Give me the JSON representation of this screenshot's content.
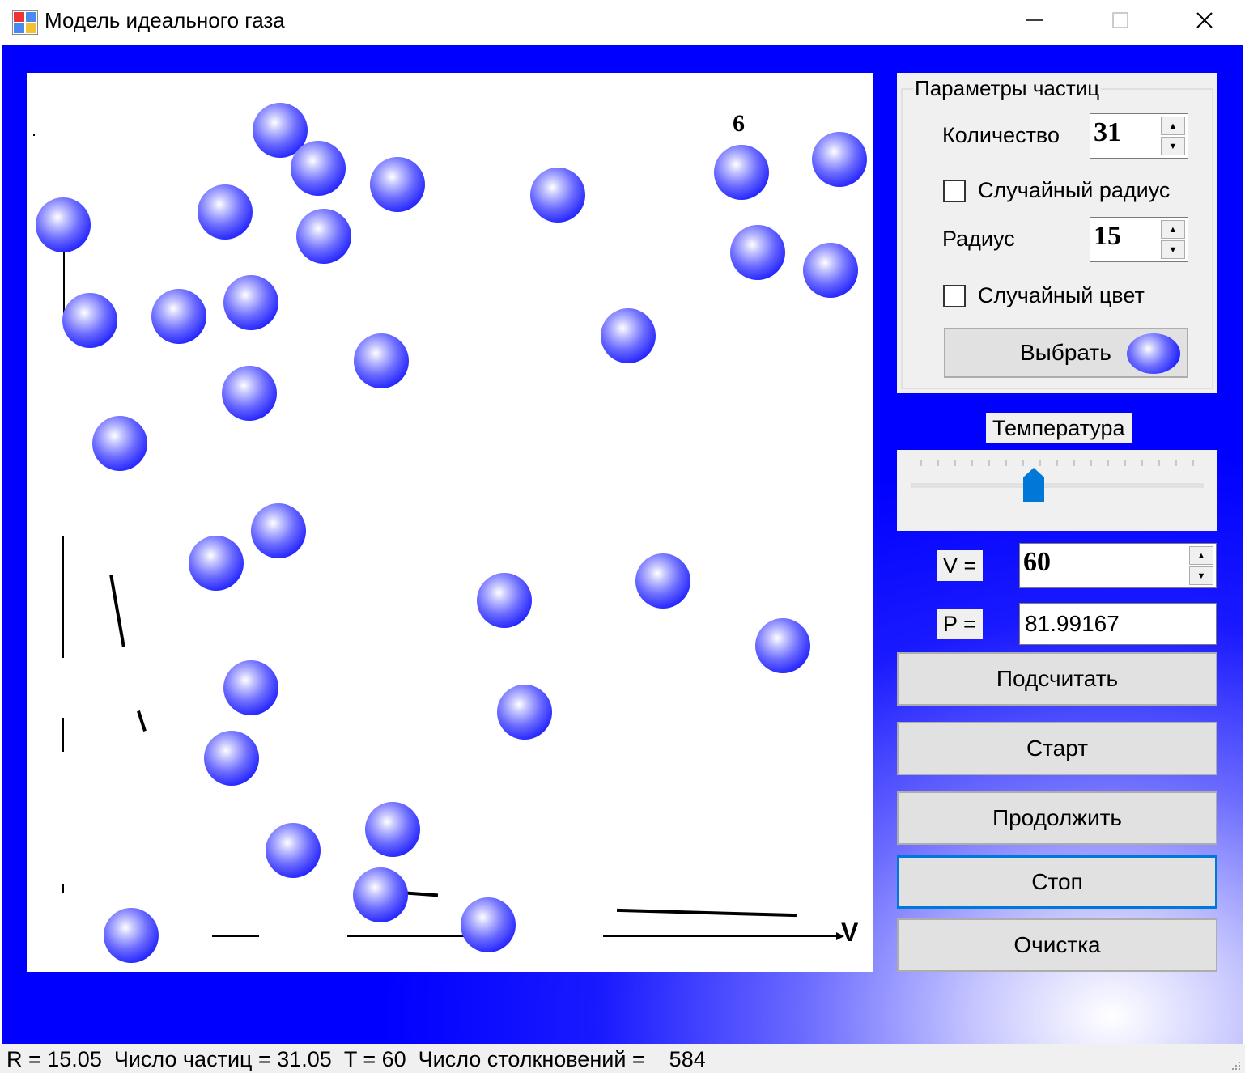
{
  "window": {
    "title": "Модель идеального газа"
  },
  "params_group": {
    "caption": "Параметры частиц",
    "count_label": "Количество",
    "count_value": "31",
    "random_radius_label": "Случайный радиус",
    "random_radius_checked": false,
    "radius_label": "Радиус",
    "radius_value": "15",
    "random_color_label": "Случайный цвет",
    "random_color_checked": false,
    "choose_button": "Выбрать"
  },
  "temperature": {
    "label": "Температура",
    "level_fraction": 0.42
  },
  "volume": {
    "label": "V =",
    "value": "60"
  },
  "pressure": {
    "label": "P =",
    "value": "81.99167"
  },
  "buttons": {
    "calculate": "Подсчитать",
    "start": "Старт",
    "continue": "Продолжить",
    "stop": "Стоп",
    "clear": "Очистка"
  },
  "canvas": {
    "axis_label": "V",
    "digit": "6",
    "particle_color": "#1f1fff"
  },
  "status": {
    "text": "R = 15.05  Число частиц = 31.05  T = 60  Число столкновений =    584"
  }
}
